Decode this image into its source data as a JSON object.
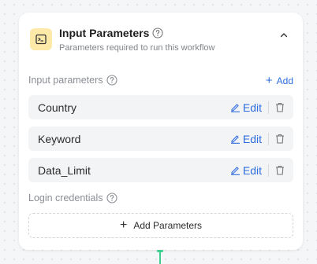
{
  "header": {
    "title": "Input Parameters",
    "subtitle": "Parameters required to run this workflow",
    "icon": "terminal-icon",
    "accent_color": "#fde9a8"
  },
  "input_section": {
    "label": "Input parameters",
    "add_label": "Add"
  },
  "parameters": [
    {
      "name": "Country",
      "edit_label": "Edit"
    },
    {
      "name": "Keyword",
      "edit_label": "Edit"
    },
    {
      "name": "Data_Limit",
      "edit_label": "Edit"
    }
  ],
  "login_section": {
    "label": "Login credentials",
    "add_parameters_label": "Add Parameters"
  },
  "colors": {
    "link": "#2d6cdf",
    "connector": "#3ecf8e"
  }
}
